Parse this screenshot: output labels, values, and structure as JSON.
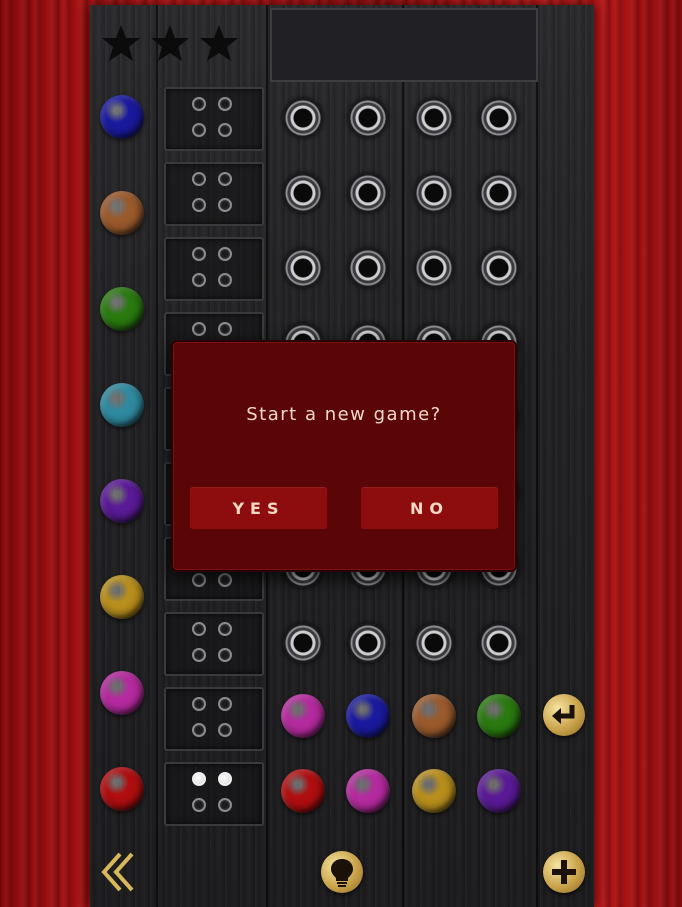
{
  "dialog": {
    "message": "Start a new game?",
    "yes_label": "YES",
    "no_label": "NO",
    "background": "#5a0607",
    "button_color": "#8d0d0f"
  },
  "stars": {
    "count": 3,
    "earned": 0
  },
  "palette": [
    {
      "name": "blue",
      "color": "#1a1a9e"
    },
    {
      "name": "brown",
      "color": "#9a5a2c"
    },
    {
      "name": "green",
      "color": "#2a7a10"
    },
    {
      "name": "teal",
      "color": "#2f8aa0"
    },
    {
      "name": "purple",
      "color": "#5a1a96"
    },
    {
      "name": "gold",
      "color": "#b88e1c"
    },
    {
      "name": "magenta",
      "color": "#b52a9e"
    },
    {
      "name": "red",
      "color": "#b00e10"
    }
  ],
  "current_guess": [
    "magenta",
    "blue",
    "brown",
    "green"
  ],
  "previous_guess": [
    "red",
    "magenta",
    "gold",
    "purple"
  ],
  "previous_feedback": {
    "white": 2,
    "black": 0
  },
  "icons": {
    "back": "double-chevron-left-icon",
    "hint": "lightbulb-icon",
    "new_game": "plus-icon",
    "submit": "return-arrow-icon"
  }
}
